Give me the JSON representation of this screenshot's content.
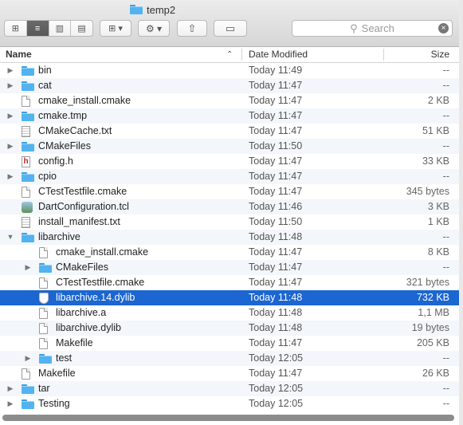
{
  "window": {
    "title": "temp2"
  },
  "toolbar": {
    "view_icons": "⊞",
    "view_list": "≡",
    "view_columns": "▥",
    "view_coverflow": "▤",
    "arrange_label": "⊞ ▾",
    "action_label": "⚙ ▾",
    "share_label": "⇧",
    "tag_label": "▭"
  },
  "search": {
    "placeholder": "Search",
    "glass": "🔍",
    "clear": "×"
  },
  "columns": {
    "name": "Name",
    "date": "Date Modified",
    "size": "Size",
    "sort_indicator": "⌃"
  },
  "rows": [
    {
      "name": "bin",
      "date": "Today 11:49",
      "size": "--",
      "kind": "folder",
      "level": 0,
      "disclosure": "right"
    },
    {
      "name": "cat",
      "date": "Today 11:47",
      "size": "--",
      "kind": "folder",
      "level": 0,
      "disclosure": "right"
    },
    {
      "name": "cmake_install.cmake",
      "date": "Today 11:47",
      "size": "2 KB",
      "kind": "doc",
      "level": 0,
      "disclosure": "none"
    },
    {
      "name": "cmake.tmp",
      "date": "Today 11:47",
      "size": "--",
      "kind": "folder",
      "level": 0,
      "disclosure": "right"
    },
    {
      "name": "CMakeCache.txt",
      "date": "Today 11:47",
      "size": "51 KB",
      "kind": "txt",
      "level": 0,
      "disclosure": "none"
    },
    {
      "name": "CMakeFiles",
      "date": "Today 11:50",
      "size": "--",
      "kind": "folder",
      "level": 0,
      "disclosure": "right"
    },
    {
      "name": "config.h",
      "date": "Today 11:47",
      "size": "33 KB",
      "kind": "h",
      "level": 0,
      "disclosure": "none"
    },
    {
      "name": "cpio",
      "date": "Today 11:47",
      "size": "--",
      "kind": "folder",
      "level": 0,
      "disclosure": "right"
    },
    {
      "name": "CTestTestfile.cmake",
      "date": "Today 11:47",
      "size": "345 bytes",
      "kind": "doc",
      "level": 0,
      "disclosure": "none"
    },
    {
      "name": "DartConfiguration.tcl",
      "date": "Today 11:46",
      "size": "3 KB",
      "kind": "tcl",
      "level": 0,
      "disclosure": "none"
    },
    {
      "name": "install_manifest.txt",
      "date": "Today 11:50",
      "size": "1 KB",
      "kind": "txt",
      "level": 0,
      "disclosure": "none"
    },
    {
      "name": "libarchive",
      "date": "Today 11:48",
      "size": "--",
      "kind": "folder",
      "level": 0,
      "disclosure": "down"
    },
    {
      "name": "cmake_install.cmake",
      "date": "Today 11:47",
      "size": "8 KB",
      "kind": "doc",
      "level": 1,
      "disclosure": "none"
    },
    {
      "name": "CMakeFiles",
      "date": "Today 11:47",
      "size": "--",
      "kind": "folder",
      "level": 1,
      "disclosure": "right"
    },
    {
      "name": "CTestTestfile.cmake",
      "date": "Today 11:47",
      "size": "321 bytes",
      "kind": "doc",
      "level": 1,
      "disclosure": "none"
    },
    {
      "name": "libarchive.14.dylib",
      "date": "Today 11:48",
      "size": "732 KB",
      "kind": "dylib",
      "level": 1,
      "disclosure": "none",
      "selected": true
    },
    {
      "name": "libarchive.a",
      "date": "Today 11:48",
      "size": "1,1 MB",
      "kind": "doc",
      "level": 1,
      "disclosure": "none"
    },
    {
      "name": "libarchive.dylib",
      "date": "Today 11:48",
      "size": "19 bytes",
      "kind": "alias",
      "level": 1,
      "disclosure": "none"
    },
    {
      "name": "Makefile",
      "date": "Today 11:47",
      "size": "205 KB",
      "kind": "doc",
      "level": 1,
      "disclosure": "none"
    },
    {
      "name": "test",
      "date": "Today 12:05",
      "size": "--",
      "kind": "folder",
      "level": 1,
      "disclosure": "right"
    },
    {
      "name": "Makefile",
      "date": "Today 11:47",
      "size": "26 KB",
      "kind": "doc",
      "level": 0,
      "disclosure": "none"
    },
    {
      "name": "tar",
      "date": "Today 12:05",
      "size": "--",
      "kind": "folder",
      "level": 0,
      "disclosure": "right"
    },
    {
      "name": "Testing",
      "date": "Today 12:05",
      "size": "--",
      "kind": "folder",
      "level": 0,
      "disclosure": "right"
    }
  ],
  "colors": {
    "selection": "#1b66d0",
    "folder": "#52b3f0",
    "alt_row": "#f3f6fa"
  }
}
